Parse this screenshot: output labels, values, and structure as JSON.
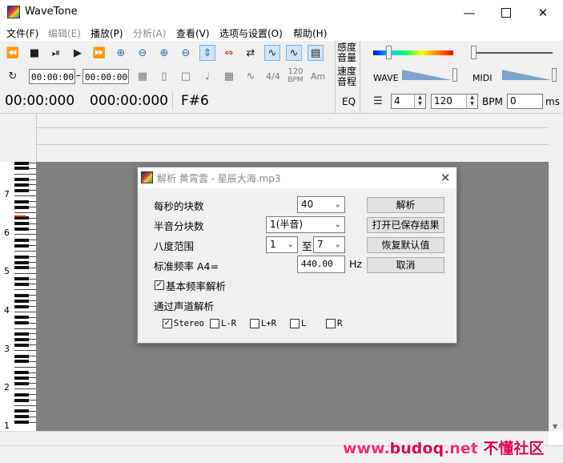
{
  "window": {
    "title": "WaveTone",
    "minimize_icon": "minimize-icon",
    "maximize_icon": "maximize-icon",
    "close_icon": "close-icon"
  },
  "menu": [
    {
      "label": "文件(F)",
      "enabled": true
    },
    {
      "label": "编辑(E)",
      "enabled": false
    },
    {
      "label": "播放(P)",
      "enabled": true
    },
    {
      "label": "分析(A)",
      "enabled": false
    },
    {
      "label": "查看(V)",
      "enabled": true
    },
    {
      "label": "选项与设置(O)",
      "enabled": true
    },
    {
      "label": "帮助(H)",
      "enabled": true
    }
  ],
  "toolbar": {
    "time_start": "00:00:000",
    "time_end": "00:00:000",
    "current_time": "00:00:000",
    "total_time": "000:00:000",
    "note": "F#6",
    "time_sig": "4/4",
    "bpm_number": "120",
    "bpm_small": "BPM",
    "am_label": "Am",
    "sensitivity_label_1": "感度",
    "sensitivity_label_2": "音量",
    "speed_label_1": "速度",
    "speed_label_2": "音程",
    "eq_label": "EQ",
    "wave_label": "WAVE",
    "midi_label": "MIDI",
    "beats_value": "4",
    "tempo_value": "120",
    "bpm_label": "BPM",
    "offset_value": "0",
    "ms_label": "ms"
  },
  "piano": {
    "octaves": [
      "7",
      "6",
      "5",
      "4",
      "3",
      "2",
      "1"
    ]
  },
  "dialog": {
    "title": "解析 黄霄雲 - 星辰大海.mp3",
    "blocks_per_sec_label": "每秒的块数",
    "blocks_per_sec_value": "40",
    "semitone_blocks_label": "半音分块数",
    "semitone_blocks_value": "1(半音)",
    "octave_range_label": "八度范围",
    "octave_from": "1",
    "octave_to_label": "至",
    "octave_to": "7",
    "std_freq_label": "标准频率 A4=",
    "std_freq_value": "440.00",
    "hz_label": "Hz",
    "fundamental_label": "基本频率解析",
    "fundamental_checked": true,
    "channel_label": "通过声道解析",
    "channels": [
      {
        "label": "Stereo",
        "checked": true
      },
      {
        "label": "L-R",
        "checked": false
      },
      {
        "label": "L+R",
        "checked": false
      },
      {
        "label": "L",
        "checked": false
      },
      {
        "label": "R",
        "checked": false
      }
    ],
    "buttons": {
      "analyze": "解析",
      "open_saved": "打开已保存结果",
      "restore_default": "恢复默认值",
      "cancel": "取消"
    }
  },
  "watermark": {
    "prefix": "www.",
    "brand": "budoq",
    "suffix": ".net",
    "cn": "不懂社区"
  }
}
